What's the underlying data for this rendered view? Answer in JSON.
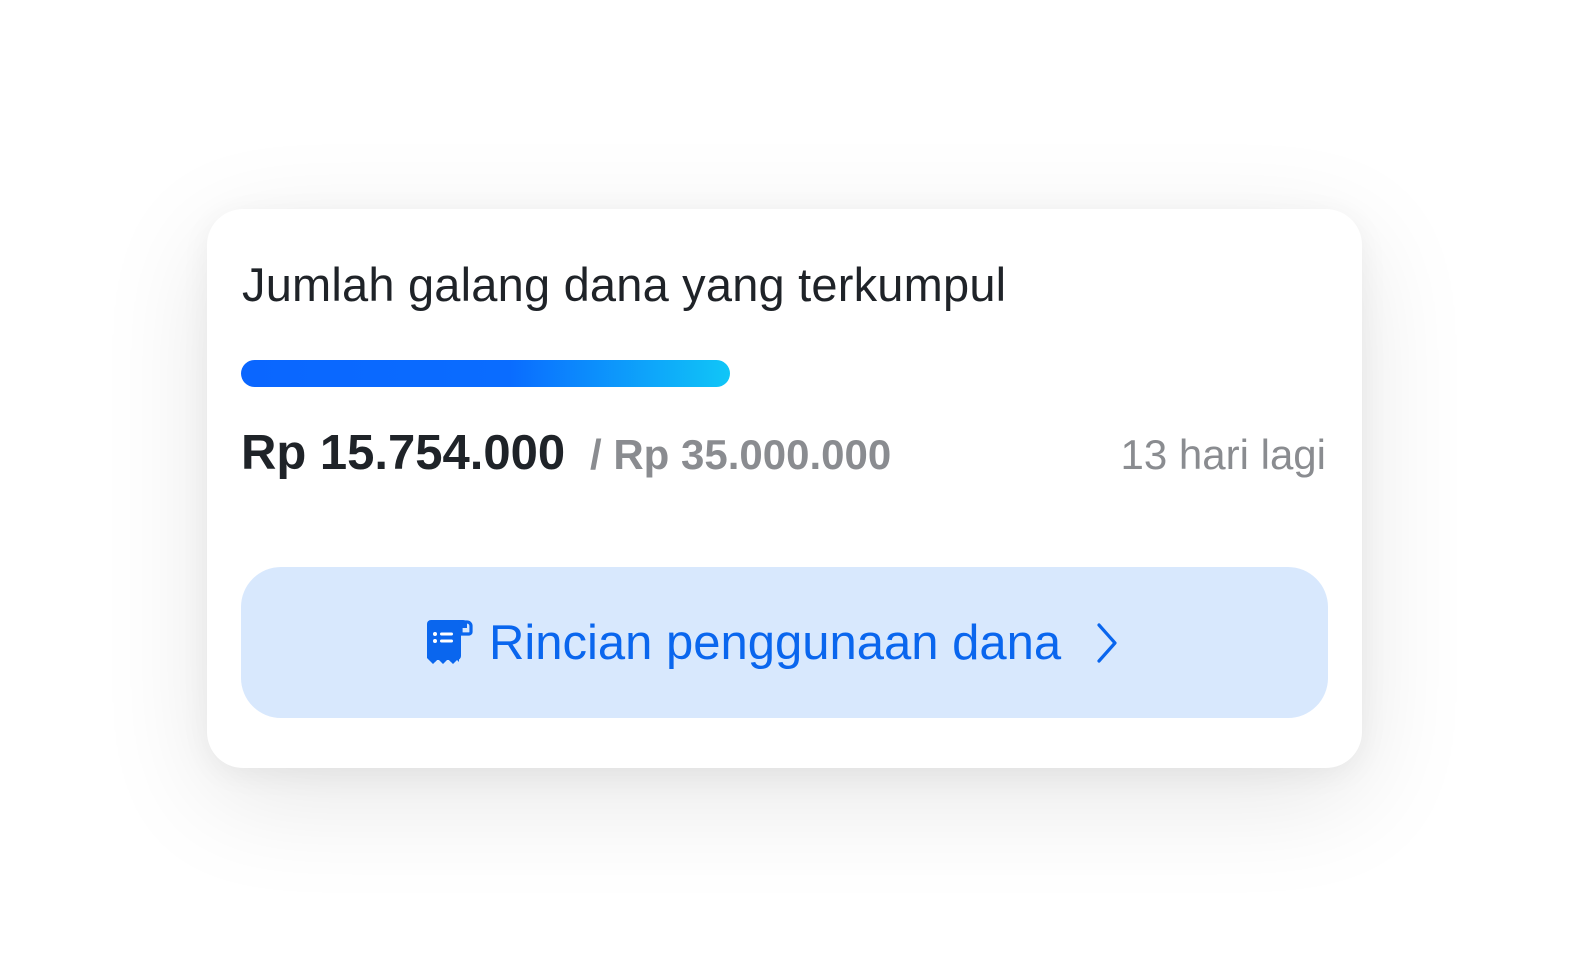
{
  "campaign": {
    "title": "Jumlah galang dana yang terkumpul",
    "progress_fraction": 0.45,
    "collected_amount": "Rp 15.754.000",
    "target_amount": "/ Rp 35.000.000",
    "days_left": "13 hari lagi"
  },
  "detail_button": {
    "label": "Rincian penggunaan dana",
    "icon": "receipt-icon",
    "trailing_icon": "chevron-right-icon"
  },
  "colors": {
    "accent": "#0a66ee",
    "progress_start": "#0a66ff",
    "progress_end": "#10c6f7",
    "button_bg": "#d8e8fd",
    "muted_text": "#8a8c90",
    "primary_text": "#1f2328"
  }
}
